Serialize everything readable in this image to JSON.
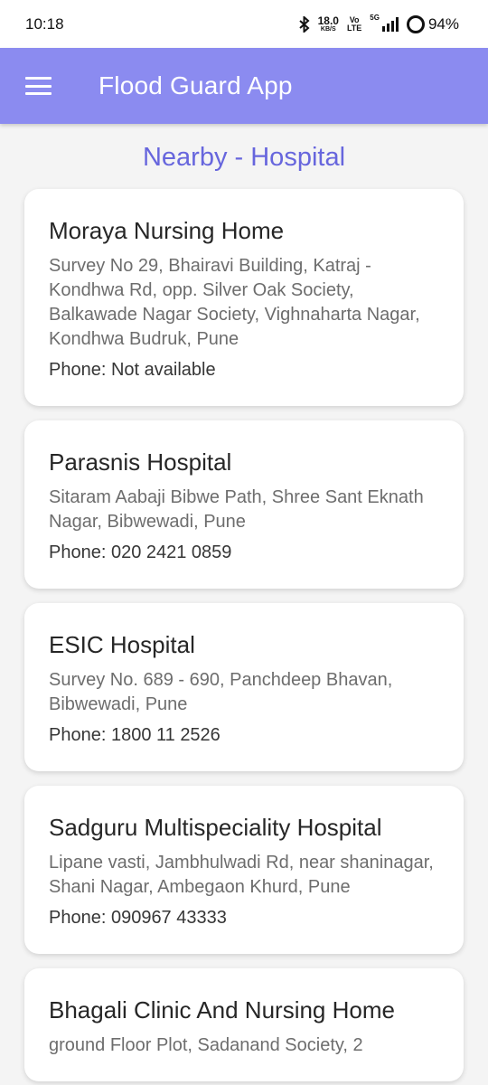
{
  "status_bar": {
    "time": "10:18",
    "net_speed_value": "18.0",
    "net_speed_unit": "KB/S",
    "volte_top": "Vo",
    "volte_bottom": "LTE",
    "network": "5G",
    "battery": "94%"
  },
  "app_bar": {
    "title": "Flood Guard App"
  },
  "section": {
    "title": "Nearby - Hospital"
  },
  "hospitals": [
    {
      "name": "Moraya Nursing Home",
      "address": "Survey No 29, Bhairavi Building, Katraj - Kondhwa Rd, opp. Silver Oak Society, Balkawade Nagar Society, Vighnaharta Nagar, Kondhwa Budruk, Pune",
      "phone": "Phone: Not available"
    },
    {
      "name": "Parasnis Hospital",
      "address": "Sitaram Aabaji Bibwe Path, Shree Sant Eknath Nagar, Bibwewadi, Pune",
      "phone": "Phone: 020 2421 0859"
    },
    {
      "name": "ESIC Hospital",
      "address": "Survey No. 689 - 690, Panchdeep Bhavan, Bibwewadi, Pune",
      "phone": "Phone: 1800 11 2526"
    },
    {
      "name": "Sadguru Multispeciality Hospital",
      "address": "Lipane vasti, Jambhulwadi Rd, near shaninagar, Shani Nagar, Ambegaon Khurd, Pune",
      "phone": "Phone: 090967 43333"
    },
    {
      "name": "Bhagali Clinic And Nursing Home",
      "address": "ground Floor Plot, Sadanand Society, 2",
      "phone": ""
    }
  ]
}
